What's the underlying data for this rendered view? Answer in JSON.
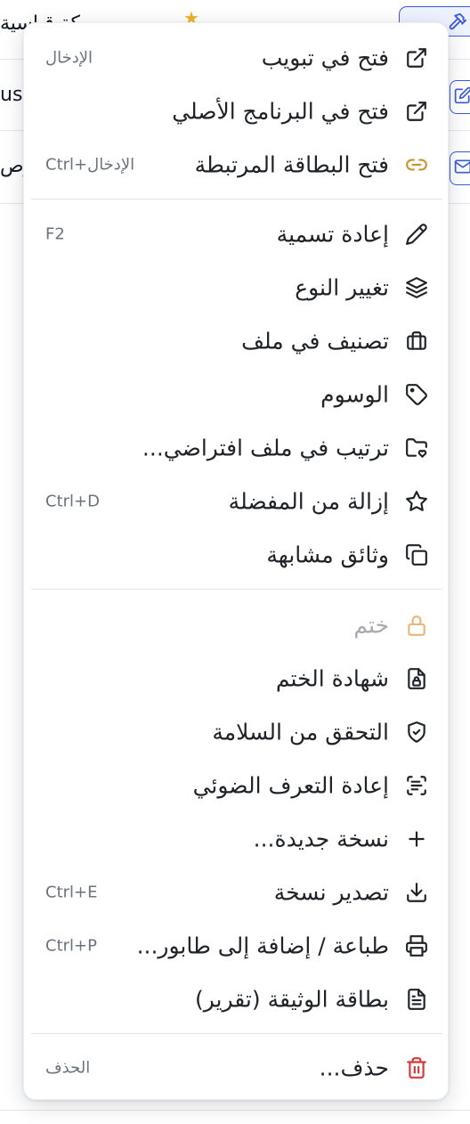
{
  "background": {
    "row1_text": "م...ركة قياسية",
    "row2_text": "us",
    "row3_text": "وص"
  },
  "menu": {
    "items": [
      {
        "label": "فتح في تبويب",
        "shortcut": "الإدخال",
        "icon": "external-link-icon"
      },
      {
        "label": "فتح في البرنامج الأصلي",
        "shortcut": "",
        "icon": "external-link-icon"
      },
      {
        "label": "فتح البطاقة المرتبطة",
        "shortcut": "Ctrl+الإدخال",
        "icon": "link-icon"
      },
      {
        "label": "إعادة تسمية",
        "shortcut": "F2",
        "icon": "pencil-icon"
      },
      {
        "label": "تغيير النوع",
        "shortcut": "",
        "icon": "layers-icon"
      },
      {
        "label": "تصنيف في ملف",
        "shortcut": "",
        "icon": "briefcase-icon"
      },
      {
        "label": "الوسوم",
        "shortcut": "",
        "icon": "tag-icon"
      },
      {
        "label": "ترتيب في ملف افتراضي...",
        "shortcut": "",
        "icon": "folder-heart-icon"
      },
      {
        "label": "إزالة من المفضلة",
        "shortcut": "Ctrl+D",
        "icon": "star-icon"
      },
      {
        "label": "وثائق مشابهة",
        "shortcut": "",
        "icon": "copy-icon"
      },
      {
        "label": "ختم",
        "shortcut": "",
        "icon": "lock-icon"
      },
      {
        "label": "شهادة الختم",
        "shortcut": "",
        "icon": "file-lock-icon"
      },
      {
        "label": "التحقق من السلامة",
        "shortcut": "",
        "icon": "shield-check-icon"
      },
      {
        "label": "إعادة التعرف الضوئي",
        "shortcut": "",
        "icon": "scan-text-icon"
      },
      {
        "label": "نسخة جديدة...",
        "shortcut": "",
        "icon": "plus-icon"
      },
      {
        "label": "تصدير نسخة",
        "shortcut": "Ctrl+E",
        "icon": "download-icon"
      },
      {
        "label": "طباعة / إضافة إلى طابور...",
        "shortcut": "Ctrl+P",
        "icon": "printer-icon"
      },
      {
        "label": "بطاقة الوثيقة (تقرير)",
        "shortcut": "",
        "icon": "file-text-icon"
      },
      {
        "label": "حذف...",
        "shortcut": "الحذف",
        "icon": "trash-icon"
      }
    ]
  },
  "colors": {
    "text": "#1f2328",
    "muted": "#6b7280",
    "disabled": "#a7a9ae",
    "link_icon": "#c8962e",
    "lock_icon": "#e8b77a",
    "danger_icon": "#d9383a",
    "accent": "#3b5bdb"
  }
}
